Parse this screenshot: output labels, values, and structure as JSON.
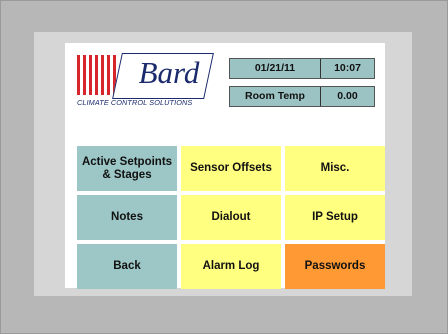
{
  "logo": {
    "brand": "Bard",
    "tagline": "CLIMATE CONTROL SOLUTIONS"
  },
  "status": {
    "date": "01/21/11",
    "time": "10:07",
    "room_temp_label": "Room Temp",
    "room_temp_value": "0.00"
  },
  "buttons": {
    "active_setpoints": "Active Setpoints & Stages",
    "sensor_offsets": "Sensor Offsets",
    "misc": "Misc.",
    "notes": "Notes",
    "dialout": "Dialout",
    "ip_setup": "IP Setup",
    "back": "Back",
    "alarm_log": "Alarm Log",
    "passwords": "Passwords"
  },
  "colors": {
    "teal": "#9dc6c6",
    "yellow": "#ffff80",
    "orange": "#ff9933",
    "logo_red": "#d7262b",
    "logo_navy": "#1a2a6c"
  }
}
